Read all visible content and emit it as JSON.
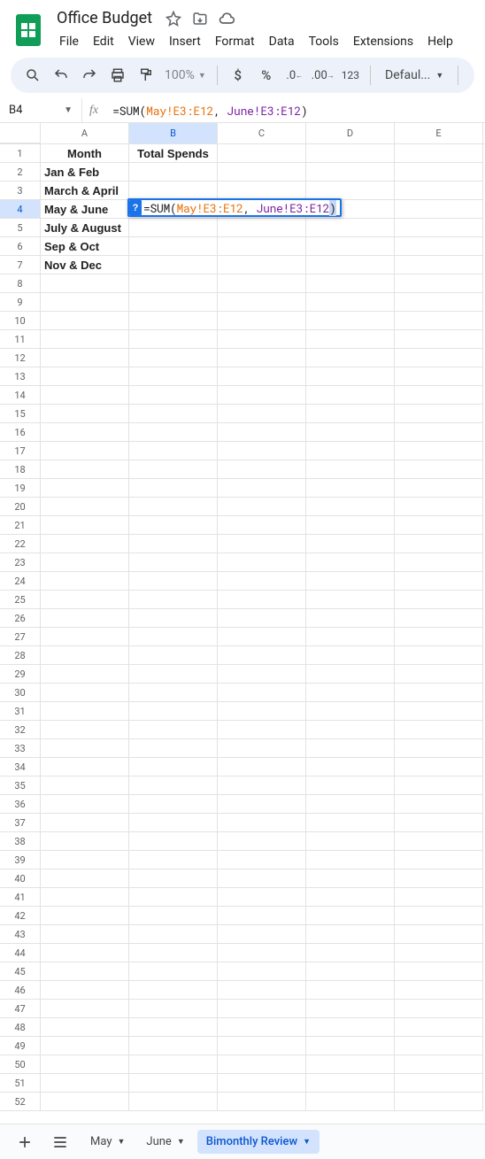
{
  "doc": {
    "title": "Office Budget"
  },
  "menu": [
    "File",
    "Edit",
    "View",
    "Insert",
    "Format",
    "Data",
    "Tools",
    "Extensions",
    "Help"
  ],
  "toolbar": {
    "zoom": "100%",
    "num_format": "123",
    "font": "Defaul..."
  },
  "namebox": "B4",
  "formula": {
    "raw": "=SUM(May!E3:E12, June!E3:E12)",
    "eq": "=",
    "func": "SUM",
    "open": "(",
    "ref1": "May!E3:E12",
    "comma": ",",
    "space": " ",
    "ref2": "June!E3:E12",
    "close": ")"
  },
  "columns": [
    "A",
    "B",
    "C",
    "D",
    "E"
  ],
  "selected_col": "B",
  "selected_row": 4,
  "data_rows": [
    {
      "n": 1,
      "A": "Month",
      "B": "Total Spends",
      "header": true
    },
    {
      "n": 2,
      "A": "Jan & Feb"
    },
    {
      "n": 3,
      "A": "March & April"
    },
    {
      "n": 4,
      "A": "May & June",
      "editing": true
    },
    {
      "n": 5,
      "A": "July & August"
    },
    {
      "n": 6,
      "A": "Sep & Oct"
    },
    {
      "n": 7,
      "A": "Nov & Dec"
    }
  ],
  "edit_badge": "?",
  "total_rows": 52,
  "sheets": [
    {
      "name": "May",
      "active": false
    },
    {
      "name": "June",
      "active": false
    },
    {
      "name": "Bimonthly Review",
      "active": true
    }
  ]
}
